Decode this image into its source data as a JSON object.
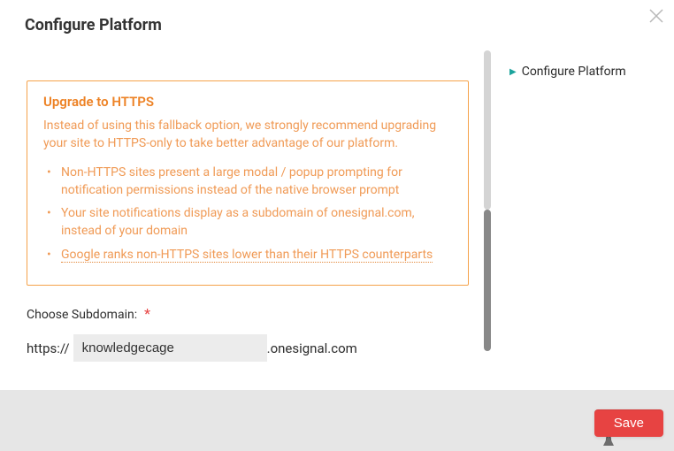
{
  "header": {
    "title": "Configure Platform"
  },
  "sidebar": {
    "items": [
      {
        "label": "Configure Platform"
      }
    ]
  },
  "callout": {
    "heading": "Upgrade to HTTPS",
    "intro": "Instead of using this fallback option, we strongly recommend upgrading your site to HTTPS-only to take better advantage of our platform.",
    "bullets": [
      "Non-HTTPS sites present a large modal / popup prompting for notification permissions instead of the native browser prompt",
      "Your site notifications display as a subdomain of onesignal.com, instead of your domain"
    ],
    "bullet_link": "Google ranks non-HTTPS sites lower than their HTTPS counterparts"
  },
  "subdomain": {
    "label": "Choose Subdomain:",
    "required_mark": "*",
    "prefix": "https://",
    "value": "knowledgecage",
    "suffix": ".onesignal.com"
  },
  "footer": {
    "save_label": "Save"
  }
}
